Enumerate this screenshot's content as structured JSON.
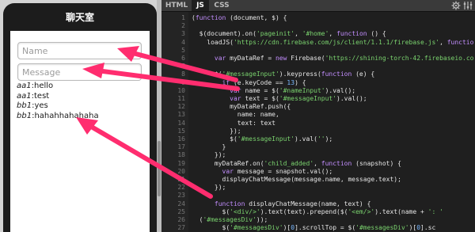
{
  "phone": {
    "title": "聊天室",
    "name_placeholder": "Name",
    "message_placeholder": "Message",
    "messages": [
      {
        "name": "aa1",
        "text": "hello"
      },
      {
        "name": "aa1",
        "text": "test"
      },
      {
        "name": "bb1",
        "text": "yes"
      },
      {
        "name": "bb1",
        "text": "hahahhahahaha"
      }
    ]
  },
  "editor": {
    "tabs": [
      "HTML",
      "JS",
      "CSS"
    ],
    "active_tab": "JS",
    "line_numbers": [
      "1",
      "2",
      "3",
      "4",
      "5",
      "6",
      "7",
      "8",
      "9",
      "10",
      "11",
      "12",
      "13",
      "14",
      "15",
      "16",
      "17",
      "18",
      "19",
      "20",
      "21",
      "22",
      "23",
      "24",
      "25",
      "26",
      "27"
    ],
    "lines": [
      "(function (document, $) {",
      "",
      "  $(document).on('pageinit', '#home', function () {",
      "    loadJS('https://cdn.firebase.com/js/client/1.1.1/firebase.js', function () {",
      "",
      "      var myDataRef = new Firebase('https://shining-torch-42.firebaseio.com/');",
      "",
      "      $('#messageInput').keypress(function (e) {",
      "        if (e.keyCode == 13) {",
      "          var name = $('#nameInput').val();",
      "          var text = $('#messageInput').val();",
      "          myDataRef.push({",
      "            name: name,",
      "            text: text",
      "          });",
      "          $('#messageInput').val('');",
      "        }",
      "      });",
      "      myDataRef.on('child_added', function (snapshot) {",
      "        var message = snapshot.val();",
      "        displayChatMessage(message.name, message.text);",
      "      });",
      "",
      "      function displayChatMessage(name, text) {",
      "        $('<div/>').text(text).prepend($('<em/>').text(name + ': '",
      "  ('#messagesDiv'));",
      "        $('#messagesDiv')[0].scrollTop = $('#messagesDiv')[0].sc",
      "      };"
    ]
  },
  "icons": {
    "settings_a": "settings-gear-icon",
    "settings_b": "sliders-icon"
  },
  "colors": {
    "arrow": "#ff2d6f",
    "keyword": "#c38eff",
    "string": "#7ad36e"
  }
}
